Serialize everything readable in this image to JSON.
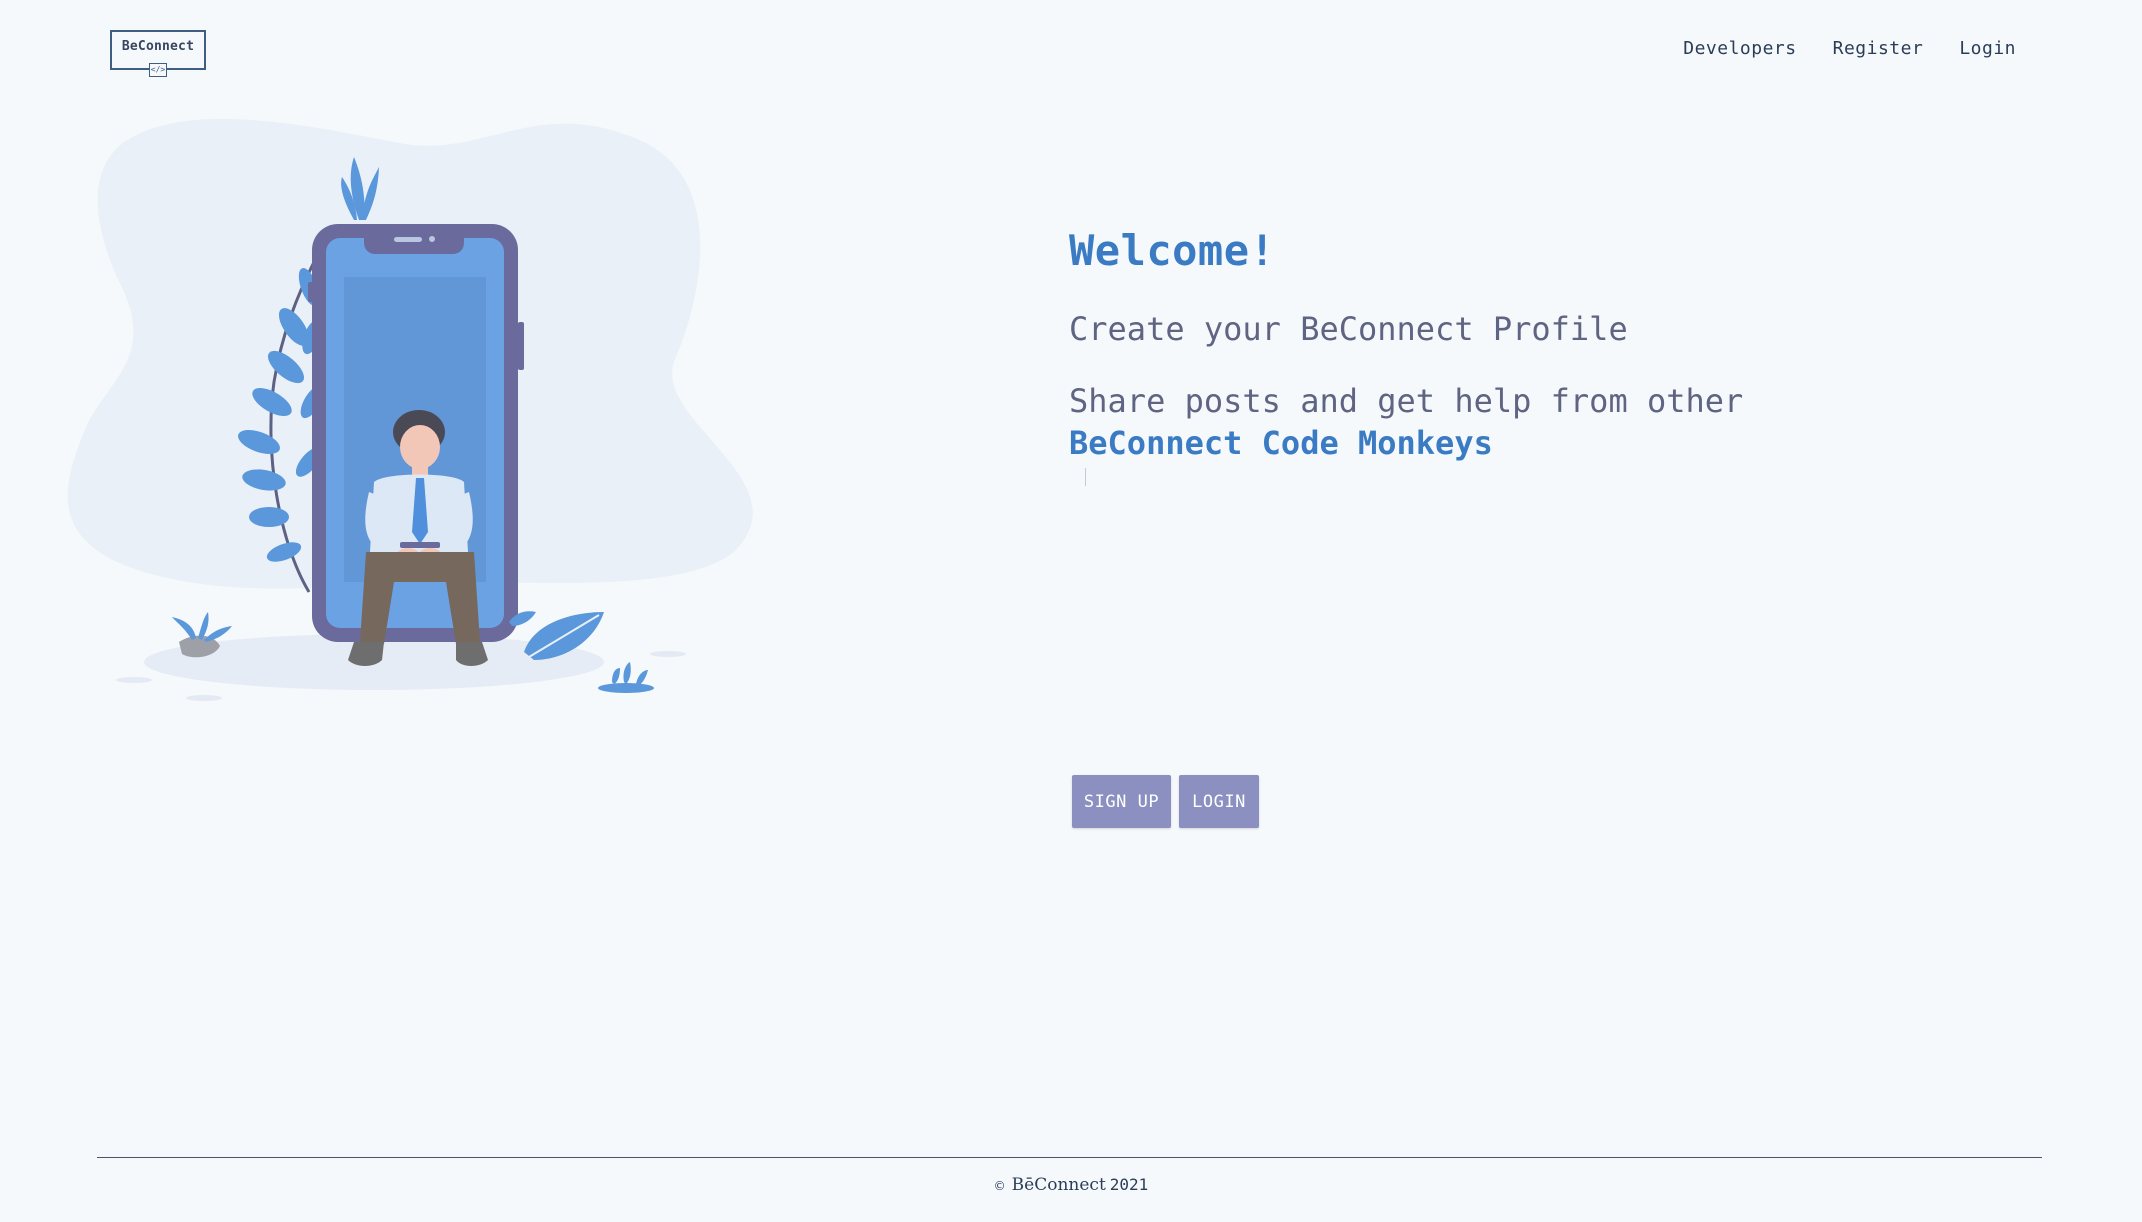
{
  "header": {
    "logo_text": "BeConnect",
    "logo_sub": "</>",
    "nav": [
      "Developers",
      "Register",
      "Login"
    ]
  },
  "hero": {
    "welcome": "Welcome!",
    "subtitle": "Create your BeConnect Profile",
    "share_line": "Share posts and get help from other",
    "highlight": "BeConnect Code Monkeys"
  },
  "buttons": {
    "signup": "SIGN UP",
    "login": "LOGIN"
  },
  "footer": {
    "copyright_symbol": "©",
    "brand": "BēConnect",
    "year": "2021"
  },
  "colors": {
    "background": "#f5f9fc",
    "accent": "#3a7bc4",
    "button": "#8b90c0",
    "text": "#5f6482",
    "nav_text": "#2c3e57"
  },
  "icons": [
    "beconnect-logo-icon",
    "person-on-phone-illustration"
  ]
}
